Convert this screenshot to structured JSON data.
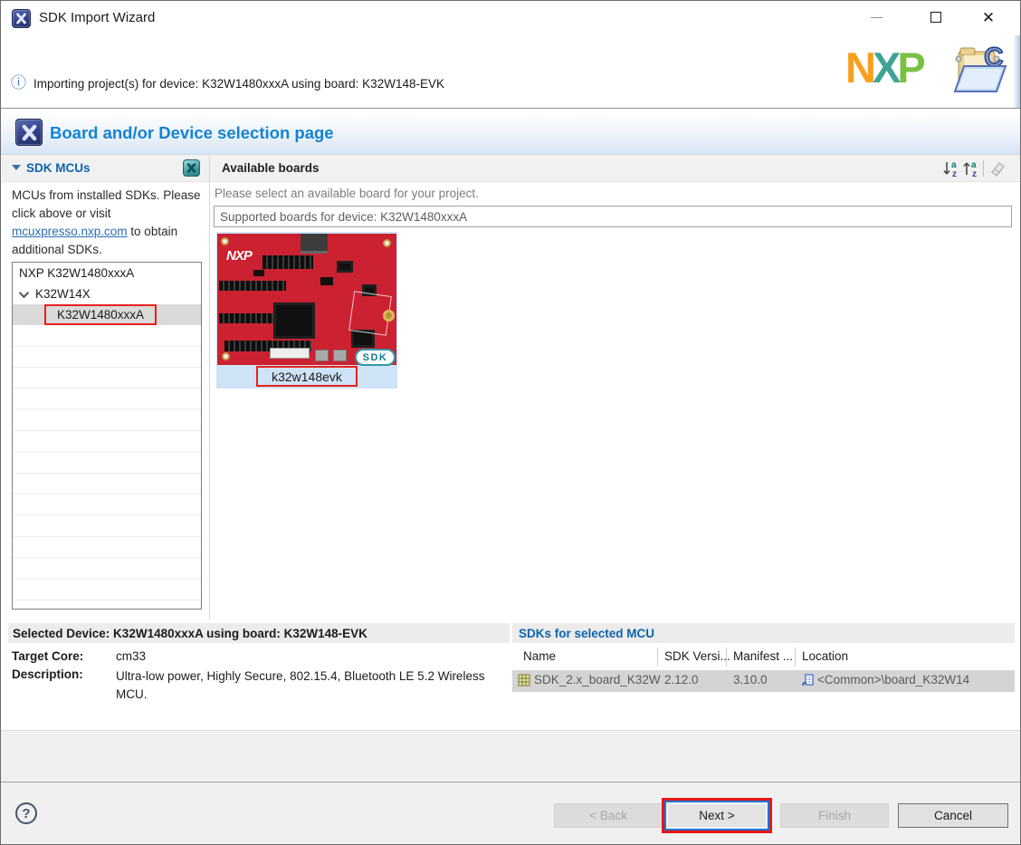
{
  "window": {
    "title": "SDK Import Wizard"
  },
  "banner": {
    "message": "Importing project(s) for device: K32W1480xxxA using board: K32W148-EVK"
  },
  "nxp_logo": {
    "n": "N",
    "x": "X",
    "p": "P"
  },
  "header": {
    "title": "Board and/or Device selection page"
  },
  "sdk_mcus": {
    "title": "SDK MCUs",
    "desc_1": "MCUs from installed SDKs. Please click above or visit ",
    "link_text": "mcuxpresso.nxp.com",
    "desc_2": " to obtain additional SDKs.",
    "tree": [
      {
        "label": "NXP K32W1480xxxA"
      },
      {
        "label": "K32W14X",
        "expanded": true
      },
      {
        "label": "K32W1480xxxA",
        "selected": true,
        "highlighted": true
      }
    ]
  },
  "boards": {
    "title": "Available boards",
    "subtitle": "Please select an available board for your project.",
    "filter_value": "Supported boards for device: K32W1480xxxA",
    "board": {
      "name": "k32w148evk",
      "badge": "SDK",
      "vendor": "NXP",
      "selected": true,
      "highlighted": true
    }
  },
  "selected_device": {
    "header": "Selected Device: K32W1480xxxA using board: K32W148-EVK",
    "target_core_label": "Target Core:",
    "target_core": "cm33",
    "description_label": "Description:",
    "description": "Ultra-low power, Highly Secure, 802.15.4, Bluetooth LE 5.2 Wireless MCU."
  },
  "sdk_table": {
    "title": "SDKs for selected MCU",
    "columns": [
      "Name",
      "SDK Versi...",
      "Manifest ...",
      "Location"
    ],
    "rows": [
      {
        "name": "SDK_2.x_board_K32W",
        "sdk_version": "2.12.0",
        "manifest": "3.10.0",
        "location": "<Common>\\board_K32W14"
      }
    ]
  },
  "footer": {
    "help_glyph": "?",
    "back_label": "< Back",
    "next_label": "Next >",
    "finish_label": "Finish",
    "cancel_label": "Cancel"
  },
  "colors": {
    "accent_blue": "#1383d2",
    "section_blue": "#0d64ad",
    "annotation_red": "#ee1414",
    "focus_blue": "#0076d7",
    "pcb_red": "#cb2130",
    "tile_blue": "#cfe3f6",
    "selected_gray": "#d4d4d4"
  }
}
